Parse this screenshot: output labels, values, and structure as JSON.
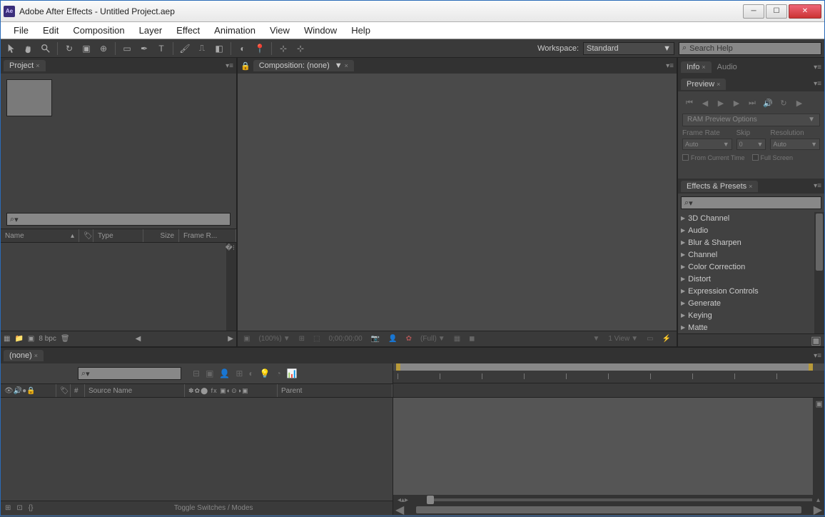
{
  "titlebar": {
    "app_abbrev": "Ae",
    "title": "Adobe After Effects - Untitled Project.aep"
  },
  "menu": {
    "file": "File",
    "edit": "Edit",
    "composition": "Composition",
    "layer": "Layer",
    "effect": "Effect",
    "animation": "Animation",
    "view": "View",
    "window": "Window",
    "help": "Help"
  },
  "toolbar": {
    "workspace_label": "Workspace:",
    "workspace_value": "Standard",
    "search_placeholder": "Search Help"
  },
  "project_panel": {
    "tab": "Project",
    "search_icon": "⌕",
    "cols": {
      "name": "Name",
      "type": "Type",
      "size": "Size",
      "framerate": "Frame R..."
    },
    "footer": {
      "bpc": "8 bpc"
    }
  },
  "comp_panel": {
    "tab": "Composition: (none)",
    "footer": {
      "zoom": "(100%)",
      "time": "0;00;00;00",
      "res": "(Full)",
      "view": "1 View"
    }
  },
  "info_panel": {
    "tab_info": "Info",
    "tab_audio": "Audio"
  },
  "preview_panel": {
    "tab": "Preview",
    "ram_preview": "RAM Preview Options",
    "framerate_label": "Frame Rate",
    "framerate_value": "Auto",
    "skip_label": "Skip",
    "skip_value": "0",
    "resolution_label": "Resolution",
    "resolution_value": "Auto",
    "from_current": "From Current Time",
    "full_screen": "Full Screen"
  },
  "effects_panel": {
    "tab": "Effects & Presets",
    "items": [
      "3D Channel",
      "Audio",
      "Blur & Sharpen",
      "Channel",
      "Color Correction",
      "Distort",
      "Expression Controls",
      "Generate",
      "Keying",
      "Matte"
    ]
  },
  "timeline": {
    "tab": "(none)",
    "cols": {
      "num": "#",
      "source_name": "Source Name",
      "parent": "Parent"
    },
    "toggle_label": "Toggle Switches / Modes"
  }
}
